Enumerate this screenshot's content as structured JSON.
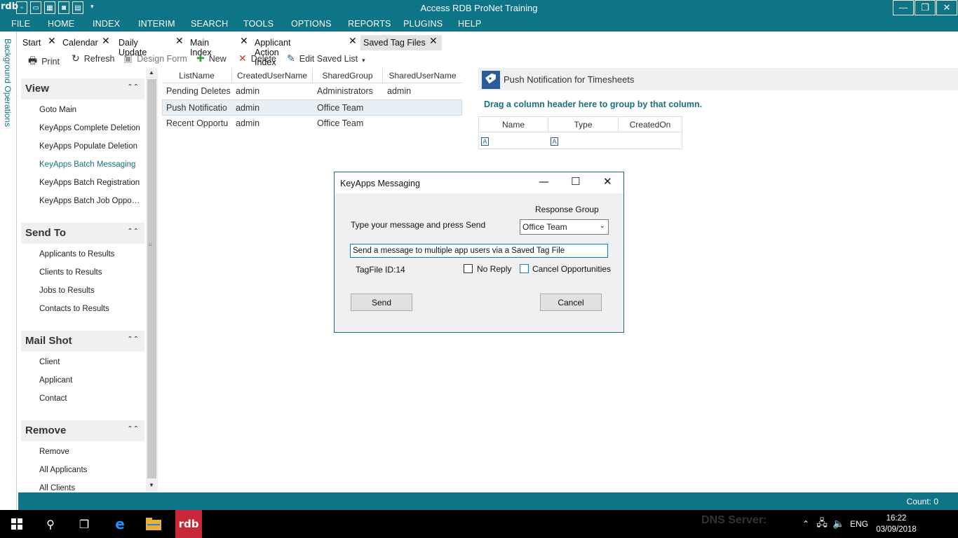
{
  "window": {
    "title": "Access RDB ProNet Training",
    "logo_text": "rdb",
    "min_label": "—",
    "restore_label": "❐",
    "close_label": "✕"
  },
  "menu": [
    "FILE",
    "HOME",
    "INDEX",
    "INTERIM",
    "SEARCH",
    "TOOLS",
    "OPTIONS",
    "REPORTS",
    "PLUGINS",
    "HELP"
  ],
  "side_strip": {
    "label": "Background Operations"
  },
  "tabs": [
    {
      "label": "Start"
    },
    {
      "label": "Calendar"
    },
    {
      "label": "Daily Update"
    },
    {
      "label": "Main Index"
    },
    {
      "label": "Applicant Action Index"
    },
    {
      "label": "Saved Tag Files"
    }
  ],
  "toolbar": {
    "print": "Print",
    "refresh": "Refresh",
    "design_form": "Design Form",
    "new": "New",
    "delete": "Delete",
    "edit_saved_list": "Edit Saved List"
  },
  "nav": {
    "sections": [
      {
        "title": "View",
        "items": [
          "Goto Main",
          "KeyApps Complete Deletion",
          "KeyApps Populate Deletion",
          "KeyApps Batch Messaging",
          "KeyApps Batch Registration",
          "KeyApps Batch Job Opportunity"
        ]
      },
      {
        "title": "Send To",
        "items": [
          "Applicants to Results",
          "Clients to Results",
          "Jobs to Results",
          "Contacts to Results"
        ]
      },
      {
        "title": "Mail Shot",
        "items": [
          "Client",
          "Applicant",
          "Contact"
        ]
      },
      {
        "title": "Remove",
        "items": [
          "Remove",
          "All Applicants",
          "All Clients"
        ]
      }
    ]
  },
  "saved_list": {
    "columns": [
      "ListName",
      "CreatedUserName",
      "SharedGroup",
      "SharedUserName"
    ],
    "rows": [
      [
        "Pending Deletes",
        "admin",
        "Administrators",
        "admin"
      ],
      [
        "Push Notificatio",
        "admin",
        "Office Team",
        ""
      ],
      [
        "Recent Opportu",
        "admin",
        "Office Team",
        ""
      ]
    ]
  },
  "detail_panel": {
    "title": "Push Notification for Timesheets",
    "group_hint": "Drag a column header here to group by that column.",
    "columns": [
      "Name",
      "Type",
      "CreatedOn"
    ],
    "filter_glyph": "A"
  },
  "status": {
    "count": "Count: 0"
  },
  "dialog": {
    "title": "KeyApps Messaging",
    "response_group_label": "Response Group",
    "prompt": "Type your message and press Send",
    "response_group_value": "Office Team",
    "message_value": "Send a message to multiple app users via a Saved Tag File",
    "tagfile": "TagFile ID:14",
    "no_reply": "No Reply",
    "cancel_opportunities": "Cancel Opportunities",
    "send": "Send",
    "cancel": "Cancel"
  },
  "taskbar": {
    "time": "16:22",
    "date": "03/09/2018",
    "lang": "ENG",
    "bg_text": "DNS Server:"
  }
}
